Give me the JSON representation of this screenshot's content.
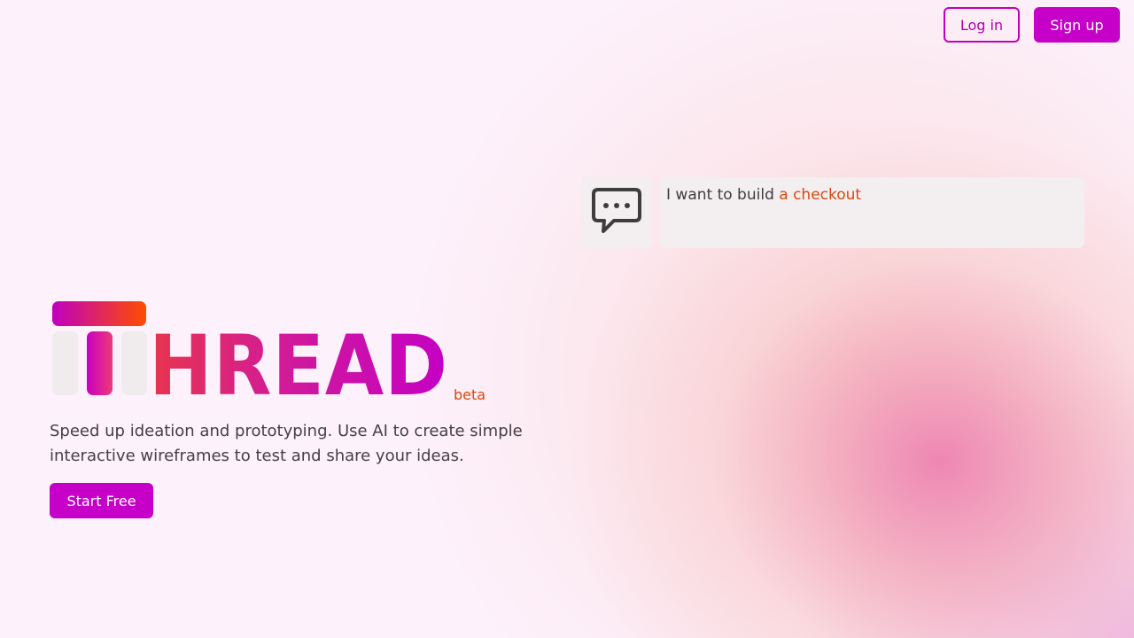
{
  "nav": {
    "login_label": "Log in",
    "signup_label": "Sign up"
  },
  "prompt": {
    "icon": "speech-bubble-icon",
    "prefix": "I want to build ",
    "highlight": "a checkout"
  },
  "hero": {
    "logo_text": "HREAD",
    "logo_badge": "beta",
    "tagline": "Speed up ideation and prototyping. Use AI to create simple interactive wireframes to test and share your ideas.",
    "cta_label": "Start Free"
  },
  "colors": {
    "brand": "#c600c8",
    "accent_orange": "#d9480f",
    "background": "#fdf1fb",
    "logo_gradient_start": "#c000c0",
    "logo_gradient_end": "#ff4d00"
  }
}
